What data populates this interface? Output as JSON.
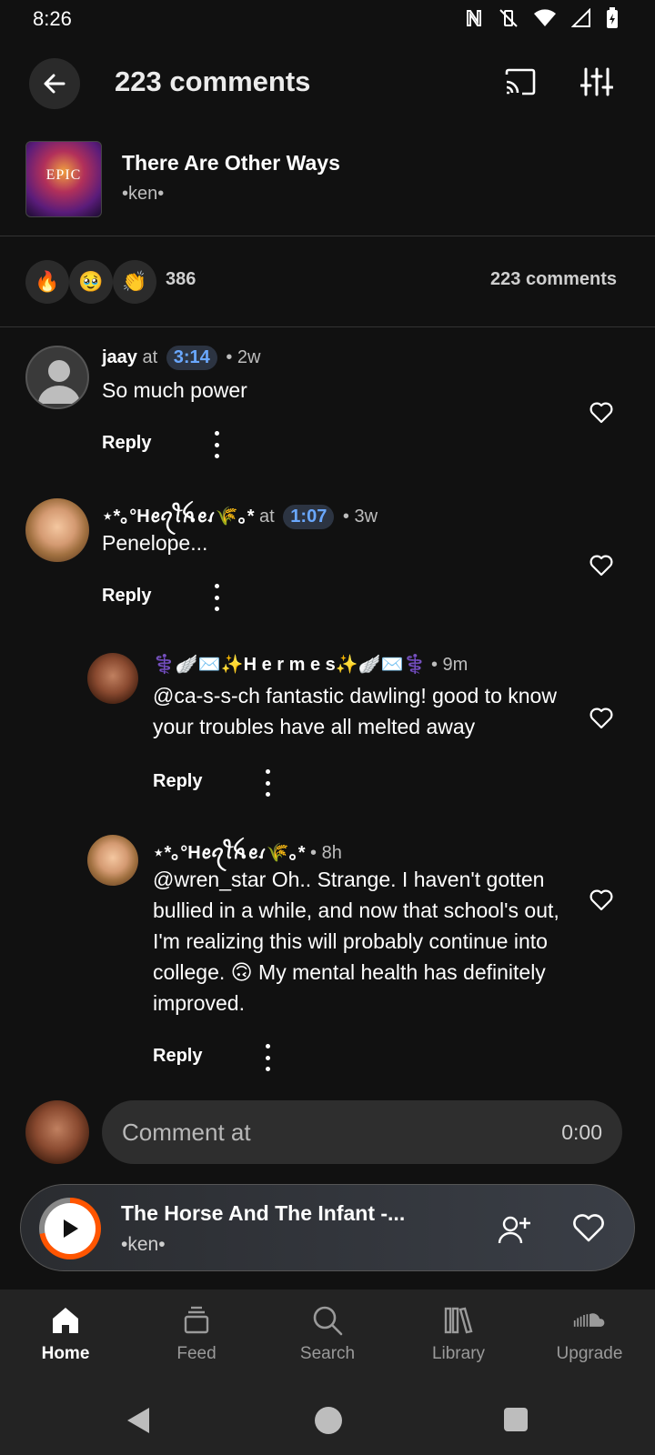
{
  "status_bar": {
    "time": "8:26"
  },
  "header": {
    "title": "223 comments"
  },
  "track": {
    "artwork_text": "EPIC",
    "title": "There Are Other Ways",
    "artist": "•ken•"
  },
  "reactions": {
    "emojis": [
      "🔥",
      "🥹",
      "👏"
    ],
    "count": "386",
    "comments_count": "223 comments"
  },
  "comments": [
    {
      "user": "jaay",
      "at": "at",
      "timestamp": "3:14",
      "age": "• 2w",
      "text": "So much power",
      "reply": "Reply"
    },
    {
      "user": "⋆*｡°Hꫀꪖꪻꫝꫀꪹ🌾｡*",
      "at": "at",
      "timestamp": "1:07",
      "age": "• 3w",
      "text": "Penelope...",
      "reply": "Reply"
    },
    {
      "user": "⚕️🪽✉️✨H e r m e s✨🪽✉️⚕️",
      "age": "• 9m",
      "text": "@ca-s-s-ch fantastic dawling! good to know your troubles have all melted away",
      "reply": "Reply"
    },
    {
      "user": "⋆*｡°Hꫀꪖꪻꫝꫀꪹ🌾｡*",
      "age": "• 8h",
      "text": "@wren_star Oh.. Strange. I haven't gotten bullied in a while, and now that school's out, I'm realizing this will probably continue into college. 🙃 My mental health has definitely improved.",
      "reply": "Reply"
    }
  ],
  "comment_input": {
    "placeholder": "Comment at",
    "time": "0:00"
  },
  "mini_player": {
    "title": "The Horse And The Infant -...",
    "artist": "•ken•",
    "accent": "#ff5500"
  },
  "nav": {
    "home": "Home",
    "feed": "Feed",
    "search": "Search",
    "library": "Library",
    "upgrade": "Upgrade"
  }
}
